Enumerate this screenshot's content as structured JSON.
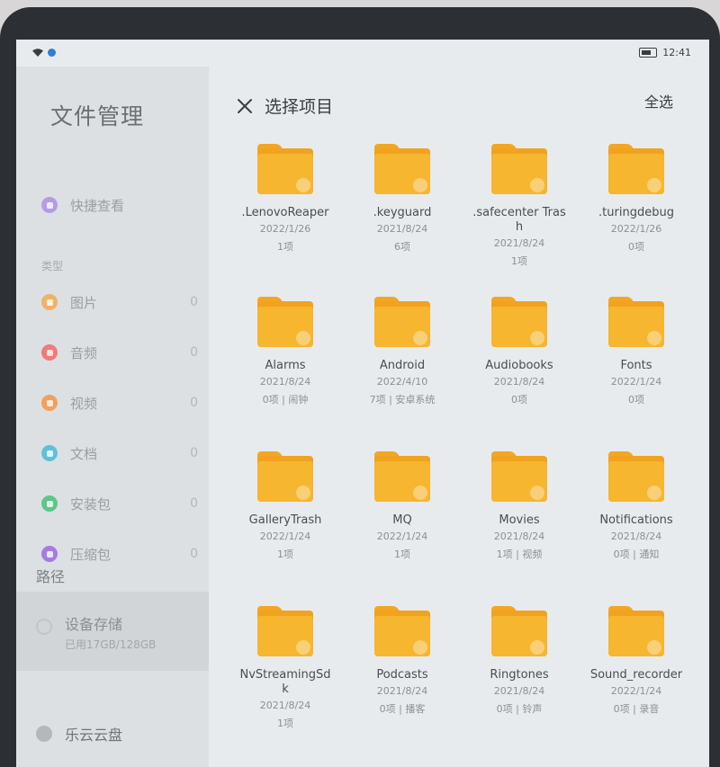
{
  "status": {
    "time": "12:41"
  },
  "sidebar": {
    "title": "文件管理",
    "quick_view": "快捷查看",
    "category_header": "类型",
    "categories": [
      {
        "label": "图片",
        "count": "0",
        "color": "#f0b266"
      },
      {
        "label": "音频",
        "count": "0",
        "color": "#ef7b7b"
      },
      {
        "label": "视频",
        "count": "0",
        "color": "#f2a05f"
      },
      {
        "label": "文档",
        "count": "0",
        "color": "#5ec1d6"
      },
      {
        "label": "安装包",
        "count": "0",
        "color": "#5ec68a"
      },
      {
        "label": "压缩包",
        "count": "0",
        "color": "#a57de0"
      }
    ],
    "path_header": "路径",
    "storage": {
      "name": "设备存储",
      "detail": "已用17GB/128GB"
    },
    "cloud": "乐云云盘"
  },
  "header": {
    "title": "选择项目",
    "select_all": "全选"
  },
  "folders": [
    {
      "name": ".LenovoReaper",
      "date": "2022/1/26",
      "info": "1项"
    },
    {
      "name": ".keyguard",
      "date": "2021/8/24",
      "info": "6项"
    },
    {
      "name": ".safecenter Trash",
      "date": "2021/8/24",
      "info": "1项"
    },
    {
      "name": ".turingdebug",
      "date": "2022/1/26",
      "info": "0项"
    },
    {
      "name": "Alarms",
      "date": "2021/8/24",
      "info": "0项 | 闹钟"
    },
    {
      "name": "Android",
      "date": "2022/4/10",
      "info": "7项 | 安卓系统"
    },
    {
      "name": "Audiobooks",
      "date": "2021/8/24",
      "info": "0项"
    },
    {
      "name": "Fonts",
      "date": "2022/1/24",
      "info": "0项"
    },
    {
      "name": "GalleryTrash",
      "date": "2022/1/24",
      "info": "1项"
    },
    {
      "name": "MQ",
      "date": "2022/1/24",
      "info": "1项"
    },
    {
      "name": "Movies",
      "date": "2021/8/24",
      "info": "1项 | 视频"
    },
    {
      "name": "Notifications",
      "date": "2021/8/24",
      "info": "0项 | 通知"
    },
    {
      "name": "NvStreamingSdk",
      "date": "2021/8/24",
      "info": "1项"
    },
    {
      "name": "Podcasts",
      "date": "2021/8/24",
      "info": "0项 | 播客"
    },
    {
      "name": "Ringtones",
      "date": "2021/8/24",
      "info": "0项 | 铃声"
    },
    {
      "name": "Sound_recorder",
      "date": "2022/1/24",
      "info": "0项 | 录音"
    }
  ]
}
